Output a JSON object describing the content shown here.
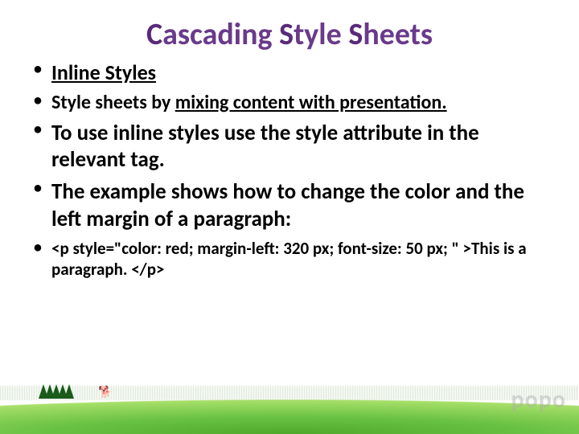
{
  "title": {
    "full": "Cascading Style Sheets",
    "w1_cap": "C",
    "w1_rest": "ascading",
    "w2_cap": "S",
    "w2_rest": "tyle",
    "w3_cap": "S",
    "w3_rest": "heets"
  },
  "bullets": {
    "b1": "Inline Styles",
    "b2_a": "Style sheets by ",
    "b2_u": "mixing content with presentation.",
    "b3_a": "To use inline styles use the ",
    "b3_b": "style attribute in the relevant tag.",
    "b4": "The example shows how to change the color and the left margin of a paragraph:",
    "b5": "<p style=\"color: red; margin-left: 320 px; font-size: 50 px; \" >This is a paragraph. </p>"
  },
  "watermark": "popo",
  "decor": {
    "animal": "🐕"
  }
}
